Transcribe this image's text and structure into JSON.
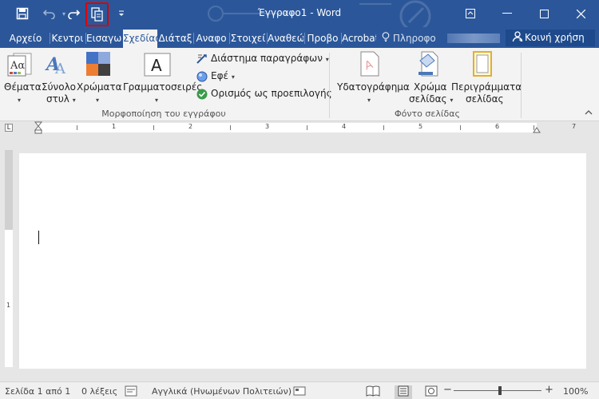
{
  "window": {
    "title": "Έγγραφο1 - Word",
    "brand_color": "#2b579a"
  },
  "qat": {
    "save_icon": "save-icon",
    "undo_icon": "undo-icon",
    "redo_icon": "redo-icon",
    "highlighted_icon": "copy-format-icon",
    "customize_icon": "chevron-down-icon",
    "highlight_color": "#e00000"
  },
  "tabs": [
    {
      "label": "Αρχείο"
    },
    {
      "label": "Κεντρι"
    },
    {
      "label": "Εισαγω"
    },
    {
      "label": "Σχεδίασ",
      "active": true
    },
    {
      "label": "Διάταξ"
    },
    {
      "label": "Αναφο"
    },
    {
      "label": "Στοιχεί"
    },
    {
      "label": "Αναθεώ"
    },
    {
      "label": "Προβο"
    },
    {
      "label": "Acrobat"
    }
  ],
  "tellme": {
    "label": "Πληροφο"
  },
  "share": {
    "label": "Κοινή χρήση"
  },
  "ribbon": {
    "themes": {
      "label": "Θέματα"
    },
    "styleset": {
      "label_line1": "Σύνολο",
      "label_line2": "στυλ"
    },
    "colors": {
      "label": "Χρώματα"
    },
    "fonts": {
      "label": "Γραμματοσειρές"
    },
    "paragraph_spacing": {
      "label": "Διάστημα παραγράφων"
    },
    "effects": {
      "label": "Εφέ"
    },
    "set_default": {
      "label": "Ορισμός ως προεπιλογής"
    },
    "group_format": {
      "label": "Μορφοποίηση του εγγράφου"
    },
    "watermark": {
      "label": "Υδατογράφημα"
    },
    "page_color": {
      "label_line1": "Χρώμα",
      "label_line2": "σελίδας"
    },
    "page_borders": {
      "label_line1": "Περιγράμματα",
      "label_line2": "σελίδας"
    },
    "group_background": {
      "label": "Φόντο σελίδας"
    }
  },
  "ruler": {
    "numbers": [
      "1",
      "2",
      "3",
      "4",
      "5",
      "6",
      "7"
    ]
  },
  "status": {
    "page": "Σελίδα 1 από 1",
    "words": "0 λέξεις",
    "language": "Αγγλικά (Ηνωμένων Πολιτειών)",
    "zoom": "100%"
  }
}
